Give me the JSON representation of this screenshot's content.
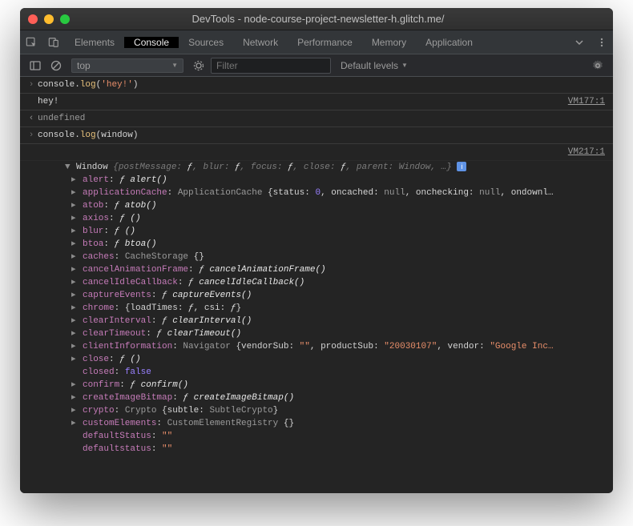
{
  "window": {
    "title": "DevTools - node-course-project-newsletter-h.glitch.me/"
  },
  "tabs": [
    "Elements",
    "Console",
    "Sources",
    "Network",
    "Performance",
    "Memory",
    "Application"
  ],
  "activeTab": "Console",
  "filterbar": {
    "context": "top",
    "filter_placeholder": "Filter",
    "levels": "Default levels"
  },
  "lines": [
    {
      "kind": "input",
      "text_html": "<span class='tk-obj'>console</span>.<span class='tk-method'>log</span><span class='tk-paren'>(</span><span class='tk-str'>'hey!'</span><span class='tk-paren'>)</span>"
    },
    {
      "kind": "output",
      "text": "hey!",
      "source": "VM177:1"
    },
    {
      "kind": "return",
      "text": "undefined"
    },
    {
      "kind": "input",
      "text_html": "<span class='tk-obj'>console</span>.<span class='tk-method'>log</span><span class='tk-paren'>(</span><span class='tk-obj'>window</span><span class='tk-paren'>)</span>"
    },
    {
      "kind": "src-only",
      "source": "VM217:1"
    }
  ],
  "windowHeader_html": "Window <span class='tk-dim'>{postMessage: <span class='tk-fn'>ƒ</span>, blur: <span class='tk-fn'>ƒ</span>, focus: <span class='tk-fn'>ƒ</span>, close: <span class='tk-fn'>ƒ</span>, parent: Window, …}</span> <span class='tk-icon-i'>i</span>",
  "props": [
    {
      "key": "alert",
      "val_html": "<span class='tk-fn'>ƒ alert()</span>"
    },
    {
      "key": "applicationCache",
      "val_html": "<span class='tk-type'>ApplicationCache</span> {status: <span class='tk-num'>0</span>, oncached: <span class='tk-null'>null</span>, onchecking: <span class='tk-null'>null</span>, ondownl…"
    },
    {
      "key": "atob",
      "val_html": "<span class='tk-fn'>ƒ atob()</span>"
    },
    {
      "key": "axios",
      "val_html": "<span class='tk-fn'>ƒ ()</span>"
    },
    {
      "key": "blur",
      "val_html": "<span class='tk-fn'>ƒ ()</span>"
    },
    {
      "key": "btoa",
      "val_html": "<span class='tk-fn'>ƒ btoa()</span>"
    },
    {
      "key": "caches",
      "val_html": "<span class='tk-type'>CacheStorage</span> {}"
    },
    {
      "key": "cancelAnimationFrame",
      "val_html": "<span class='tk-fn'>ƒ cancelAnimationFrame()</span>"
    },
    {
      "key": "cancelIdleCallback",
      "val_html": "<span class='tk-fn'>ƒ cancelIdleCallback()</span>"
    },
    {
      "key": "captureEvents",
      "val_html": "<span class='tk-fn'>ƒ captureEvents()</span>"
    },
    {
      "key": "chrome",
      "val_html": "{loadTimes: <span class='tk-fn'>ƒ</span>, csi: <span class='tk-fn'>ƒ</span>}"
    },
    {
      "key": "clearInterval",
      "val_html": "<span class='tk-fn'>ƒ clearInterval()</span>"
    },
    {
      "key": "clearTimeout",
      "val_html": "<span class='tk-fn'>ƒ clearTimeout()</span>"
    },
    {
      "key": "clientInformation",
      "val_html": "<span class='tk-type'>Navigator</span> {vendorSub: <span class='tk-str'>\"\"</span>, productSub: <span class='tk-str'>\"20030107\"</span>, vendor: <span class='tk-str'>\"Google Inc…</span>"
    },
    {
      "key": "close",
      "val_html": "<span class='tk-fn'>ƒ ()</span>"
    },
    {
      "plainKey": "closed",
      "val_html": "<span class='tk-false'>false</span>"
    },
    {
      "key": "confirm",
      "val_html": "<span class='tk-fn'>ƒ confirm()</span>"
    },
    {
      "key": "createImageBitmap",
      "val_html": "<span class='tk-fn'>ƒ createImageBitmap()</span>"
    },
    {
      "key": "crypto",
      "val_html": "<span class='tk-type'>Crypto</span> {subtle: <span class='tk-type'>SubtleCrypto</span>}"
    },
    {
      "key": "customElements",
      "val_html": "<span class='tk-type'>CustomElementRegistry</span> {}"
    },
    {
      "plainKey": "defaultStatus",
      "val_html": "<span class='tk-str'>\"\"</span>"
    },
    {
      "plainKey": "defaultstatus",
      "val_html": "<span class='tk-str'>\"\"</span>"
    }
  ]
}
